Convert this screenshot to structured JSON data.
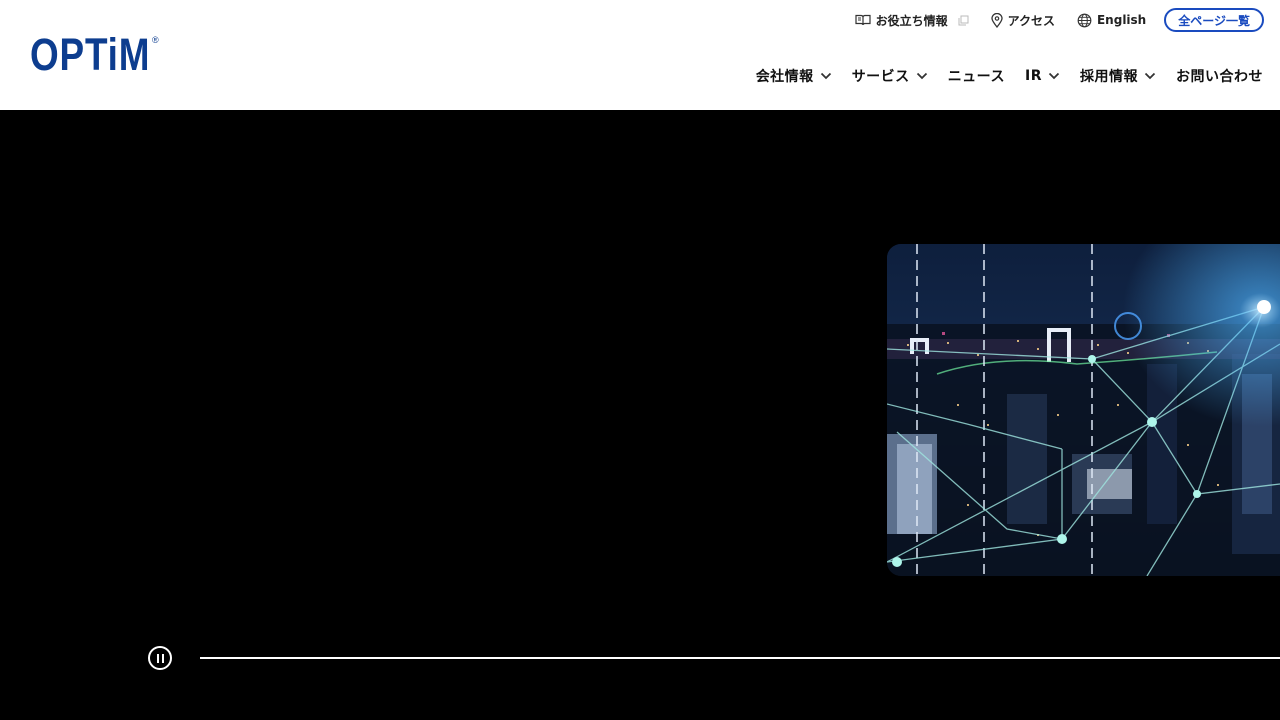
{
  "brand": {
    "name": "OPTiM",
    "registered_mark": "®",
    "color": "#0d3d8f"
  },
  "utility_nav": {
    "items": [
      {
        "label": "お役立ち情報",
        "icon": "book-icon",
        "external": true
      },
      {
        "label": "アクセス",
        "icon": "map-pin-icon"
      },
      {
        "label": "English",
        "icon": "globe-icon"
      }
    ],
    "all_pages_label": "全ページ一覧",
    "accent": "#1a4bbf"
  },
  "main_nav": {
    "items": [
      {
        "label": "会社情報",
        "has_dropdown": true
      },
      {
        "label": "サービス",
        "has_dropdown": true
      },
      {
        "label": "ニュース",
        "has_dropdown": false
      },
      {
        "label": "IR",
        "has_dropdown": true
      },
      {
        "label": "採用情報",
        "has_dropdown": true
      },
      {
        "label": "お問い合わせ",
        "has_dropdown": false
      }
    ]
  },
  "hero": {
    "image": "night-city-network-image",
    "slideshow_state": "playing",
    "pause_icon": "pause-icon"
  }
}
